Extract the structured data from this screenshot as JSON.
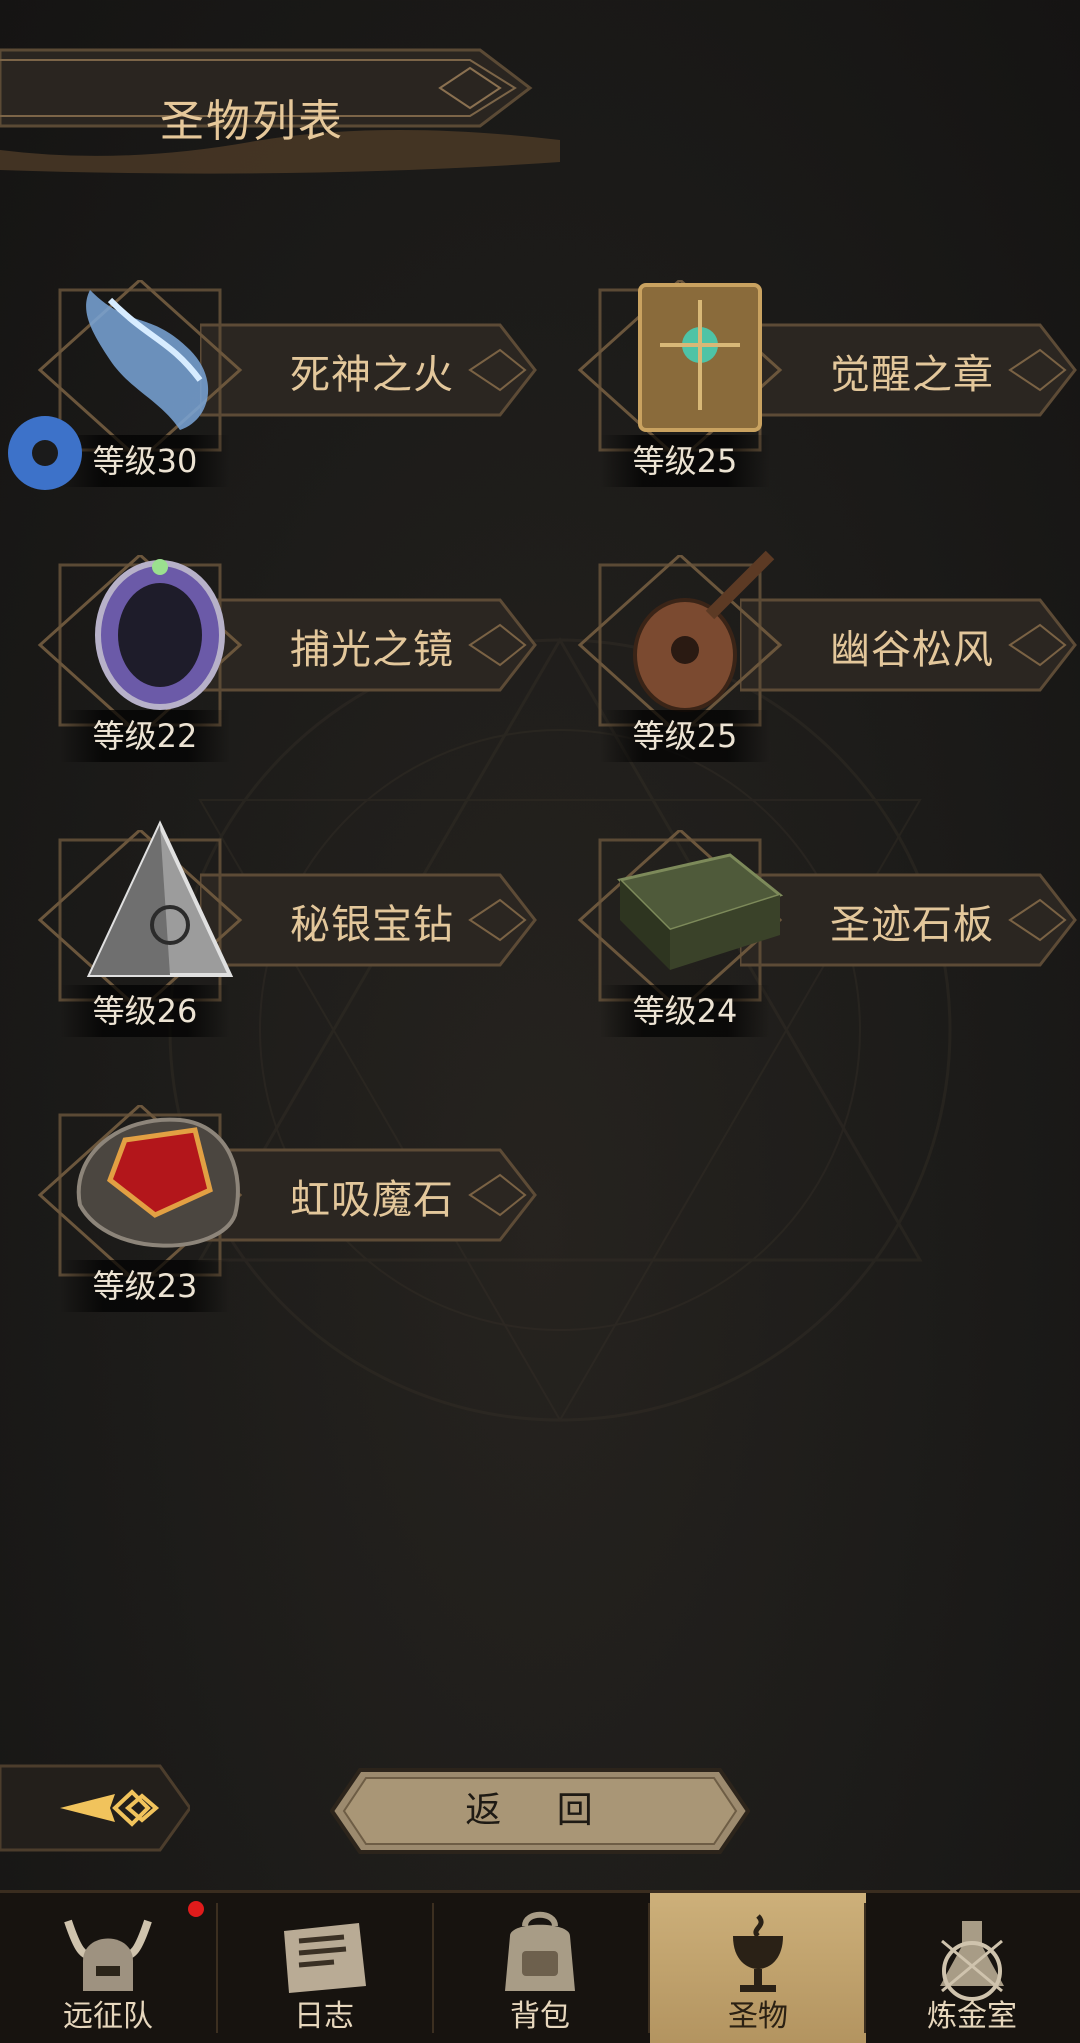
{
  "header": {
    "title": "圣物列表"
  },
  "relics": [
    {
      "name": "死神之火",
      "level": "等级30",
      "icon": "blue-flame-hand-icon"
    },
    {
      "name": "觉醒之章",
      "level": "等级25",
      "icon": "ornate-book-icon"
    },
    {
      "name": "捕光之镜",
      "level": "等级22",
      "icon": "crystal-mirror-icon"
    },
    {
      "name": "幽谷松风",
      "level": "等级25",
      "icon": "lute-icon"
    },
    {
      "name": "秘银宝钻",
      "level": "等级26",
      "icon": "silver-pyramid-icon"
    },
    {
      "name": "圣迹石板",
      "level": "等级24",
      "icon": "stone-tablet-icon"
    },
    {
      "name": "虹吸魔石",
      "level": "等级23",
      "icon": "red-gem-stone-icon"
    }
  ],
  "controls": {
    "back_label": "返 回"
  },
  "nav": {
    "items": [
      {
        "label": "远征队",
        "icon": "viking-helmet-icon",
        "active": false
      },
      {
        "label": "日志",
        "icon": "scroll-log-icon",
        "active": false
      },
      {
        "label": "背包",
        "icon": "backpack-icon",
        "active": false
      },
      {
        "label": "圣物",
        "icon": "chalice-icon",
        "active": true
      },
      {
        "label": "炼金室",
        "icon": "alchemy-flask-icon",
        "active": false
      }
    ]
  },
  "colors": {
    "gold_text": "#e3c79b",
    "nav_active": "#cdb07a",
    "notification": "#e01b1b"
  }
}
